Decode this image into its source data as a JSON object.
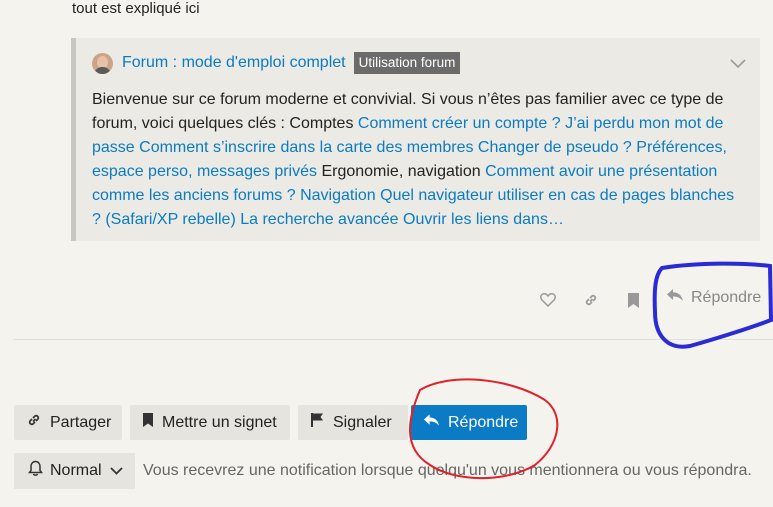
{
  "intro": {
    "text": "tout est expliqué ici"
  },
  "quote": {
    "title": "Forum : mode d'emploi complet",
    "category": "Utilisation forum",
    "segments": [
      {
        "text": "Bienvenue sur ce forum moderne et convivial. Si vous n’êtes pas familier avec ce type de forum, voici quelques clés : Comptes ",
        "link": false
      },
      {
        "text": "Comment créer un compte ? J’ai perdu mon mot de passe Comment s’inscrire dans la carte des membres Changer de pseudo ? Préférences, espace perso, messages privés",
        "link": true
      },
      {
        "text": " Ergonomie, navigation ",
        "link": false
      },
      {
        "text": "Comment avoir une présentation comme les anciens forums ? Navigation Quel navigateur utiliser en cas de pages blanches ? (Safari/XP rebelle) La recherche avancée Ouvrir les liens dans…",
        "link": true
      }
    ]
  },
  "post_actions": {
    "icons": [
      "heart-icon",
      "link-icon",
      "bookmark-icon",
      "reply-icon"
    ],
    "reply_label": "Répondre"
  },
  "footer_buttons": {
    "share_label": "Partager",
    "bookmark_label": "Mettre un signet",
    "flag_label": "Signaler",
    "reply_label": "Répondre"
  },
  "notification": {
    "level_label": "Normal",
    "description": "Vous recevrez une notification lorsque quelqu'un vous mentionnera ou vous répondra."
  },
  "colors": {
    "background": "#f4f3ee",
    "link": "#0a7bc4",
    "primary_button": "#0a7bc4",
    "annotation_blue": "#2b2bd6",
    "annotation_red": "#e0202a"
  }
}
